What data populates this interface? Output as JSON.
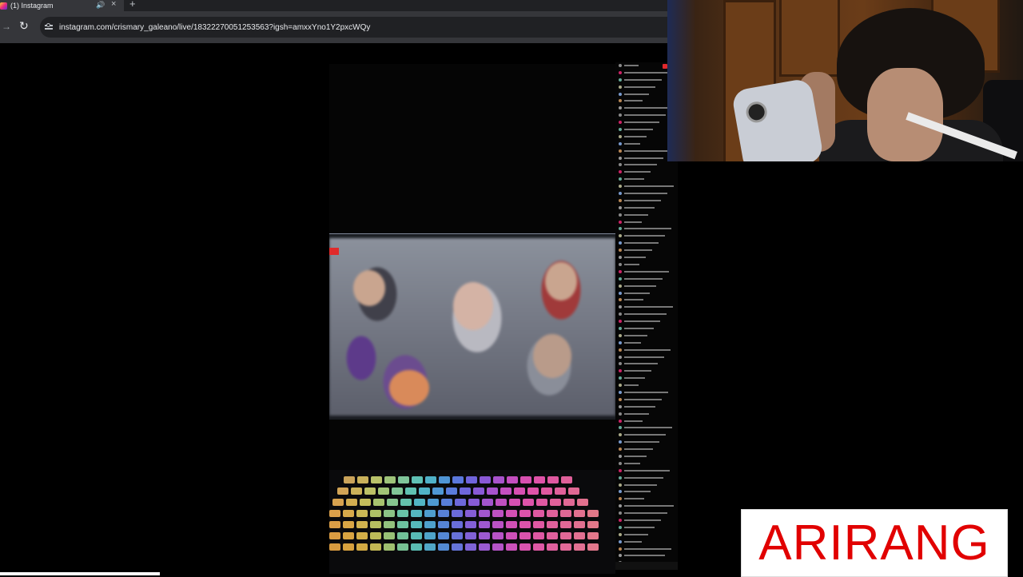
{
  "browser": {
    "tab_title": "(1) Instagram",
    "new_tab_glyph": "+",
    "close_glyph": "×",
    "audio_glyph": "🔊",
    "forward_glyph": "→",
    "reload_glyph": "↻",
    "url": "instagram.com/crismary_galeano/live/18322270051253563?igsh=amxxYno1Y2pxcWQy",
    "icons": [
      "instagram-favicon",
      "speaker-icon",
      "close-icon",
      "plus-icon",
      "forward-arrow-icon",
      "reload-icon",
      "site-info-icon"
    ]
  },
  "caption": {
    "text": "ARIRANG",
    "color": "#e10000"
  },
  "colors": {
    "chrome_dark": "#202124",
    "chrome_toolbar": "#35363a",
    "chat_live_marker": "#e0282c"
  }
}
